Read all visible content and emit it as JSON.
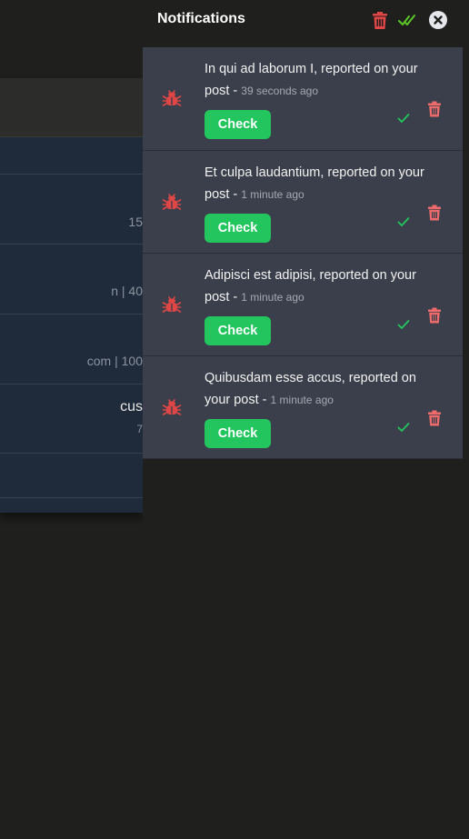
{
  "background": {
    "rows": [
      {
        "detail": "15"
      },
      {
        "detail": "n | 40"
      },
      {
        "detail": "com | 100"
      },
      {
        "name": "cus",
        "detail": "7"
      }
    ]
  },
  "panel": {
    "title": "Notifications",
    "colors": {
      "danger": "#e04646",
      "success": "#22c55e",
      "card": "#3b3f4b"
    },
    "icons": {
      "clear_all": "trash-icon",
      "mark_all_read": "double-check-icon",
      "close": "close-circle-icon"
    }
  },
  "notifications": [
    {
      "text": "In qui ad laborum I, reported on your post - ",
      "time": "39 seconds ago",
      "check_label": "Check"
    },
    {
      "text": "Et culpa laudantium, reported on your post - ",
      "time": "1 minute ago",
      "check_label": "Check"
    },
    {
      "text": "Adipisci est adipisi, reported on your post - ",
      "time": "1 minute ago",
      "check_label": "Check"
    },
    {
      "text": "Quibusdam esse accus, reported on your post - ",
      "time": "1 minute ago",
      "check_label": "Check"
    }
  ]
}
